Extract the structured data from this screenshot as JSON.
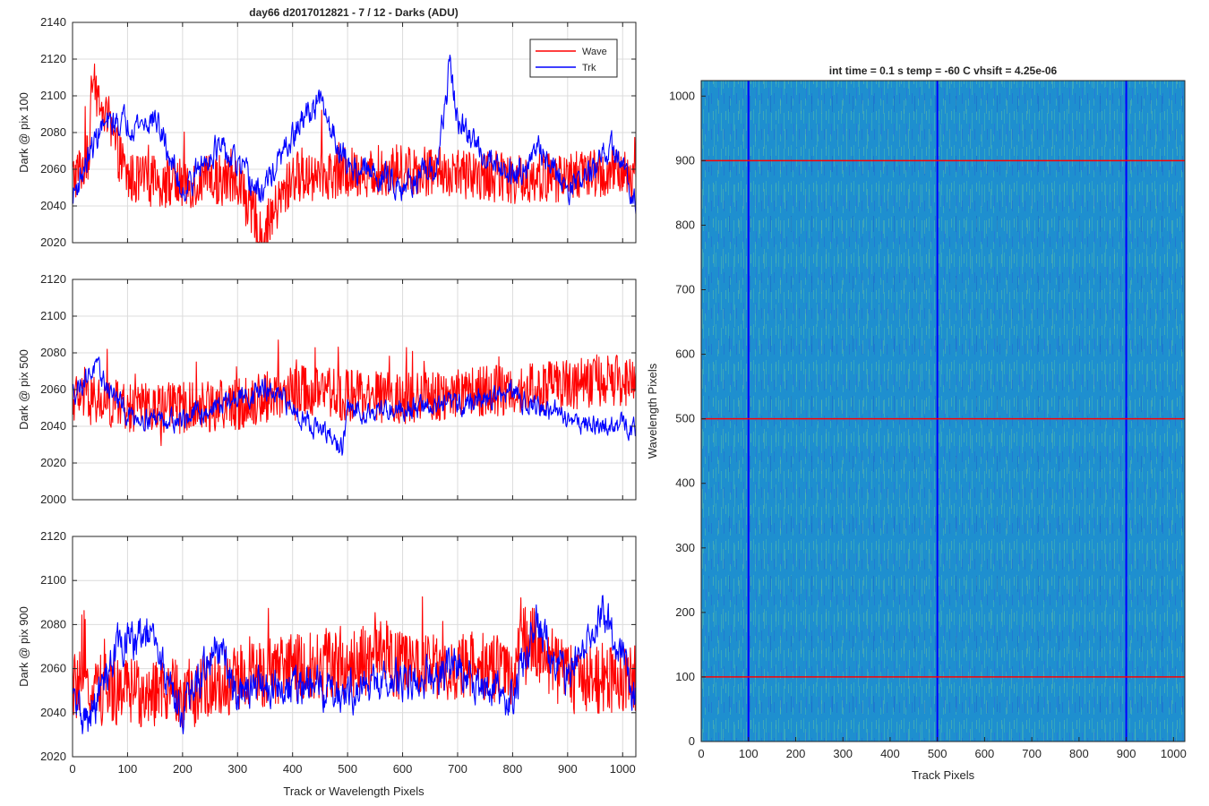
{
  "chart_data": [
    {
      "type": "line",
      "title": "day66 d2017012821 - 7 / 12 - Darks (ADU)",
      "xlabel": "",
      "ylabel": "Dark @ pix 100",
      "xlim": [
        0,
        1024
      ],
      "ylim": [
        2020,
        2140
      ],
      "xticks": [
        0,
        100,
        200,
        300,
        400,
        500,
        600,
        700,
        800,
        900,
        1000
      ],
      "yticks": [
        2020,
        2040,
        2060,
        2080,
        2100,
        2120,
        2140
      ],
      "grid": true,
      "legend": "top-right",
      "series": [
        {
          "name": "Wave",
          "color": "#ff0000",
          "x": [
            0,
            30,
            35,
            100,
            200,
            300,
            342,
            400,
            500,
            600,
            700,
            800,
            900,
            1000,
            1024
          ],
          "values": [
            2055,
            2066,
            2108,
            2055,
            2052,
            2055,
            2022,
            2056,
            2058,
            2060,
            2058,
            2055,
            2056,
            2058,
            2055
          ]
        },
        {
          "name": "Trk",
          "color": "#0000ff",
          "x": [
            0,
            50,
            80,
            130,
            150,
            200,
            260,
            300,
            340,
            430,
            450,
            500,
            600,
            660,
            680,
            685,
            700,
            750,
            800,
            850,
            900,
            950,
            980,
            1024
          ],
          "values": [
            2045,
            2082,
            2086,
            2085,
            2088,
            2048,
            2072,
            2062,
            2046,
            2092,
            2096,
            2062,
            2052,
            2058,
            2100,
            2120,
            2085,
            2068,
            2058,
            2070,
            2050,
            2060,
            2072,
            2045
          ]
        }
      ]
    },
    {
      "type": "line",
      "title": "",
      "xlabel": "",
      "ylabel": "Dark @ pix 500",
      "xlim": [
        0,
        1024
      ],
      "ylim": [
        2000,
        2120
      ],
      "xticks": [
        0,
        100,
        200,
        300,
        400,
        500,
        600,
        700,
        800,
        900,
        1000
      ],
      "yticks": [
        2000,
        2020,
        2040,
        2060,
        2080,
        2100,
        2120
      ],
      "grid": true,
      "series": [
        {
          "name": "Wave",
          "color": "#ff0000",
          "x": [
            0,
            100,
            200,
            300,
            400,
            500,
            600,
            700,
            800,
            900,
            1000,
            1024
          ],
          "values": [
            2056,
            2050,
            2050,
            2052,
            2060,
            2057,
            2055,
            2058,
            2060,
            2063,
            2065,
            2064
          ]
        },
        {
          "name": "Trk",
          "color": "#0000ff",
          "x": [
            0,
            40,
            100,
            200,
            300,
            350,
            400,
            490,
            500,
            600,
            700,
            800,
            850,
            900,
            950,
            1024
          ],
          "values": [
            2058,
            2072,
            2046,
            2044,
            2055,
            2060,
            2050,
            2028,
            2048,
            2050,
            2052,
            2058,
            2050,
            2045,
            2040,
            2040
          ]
        }
      ]
    },
    {
      "type": "line",
      "title": "",
      "xlabel": "Track or Wavelength Pixels",
      "ylabel": "Dark @ pix 900",
      "xlim": [
        0,
        1024
      ],
      "ylim": [
        2020,
        2120
      ],
      "xticks": [
        0,
        100,
        200,
        300,
        400,
        500,
        600,
        700,
        800,
        900,
        1000
      ],
      "yticks": [
        2020,
        2040,
        2060,
        2080,
        2100,
        2120
      ],
      "grid": true,
      "series": [
        {
          "name": "Wave",
          "color": "#ff0000",
          "x": [
            0,
            100,
            200,
            300,
            400,
            500,
            570,
            600,
            700,
            800,
            815,
            900,
            1000,
            1024
          ],
          "values": [
            2052,
            2050,
            2048,
            2055,
            2060,
            2062,
            2066,
            2060,
            2062,
            2058,
            2078,
            2055,
            2056,
            2055
          ]
        },
        {
          "name": "Trk",
          "color": "#0000ff",
          "x": [
            0,
            30,
            80,
            140,
            200,
            260,
            300,
            400,
            500,
            600,
            700,
            800,
            840,
            900,
            960,
            1000,
            1024
          ],
          "values": [
            2045,
            2035,
            2070,
            2075,
            2040,
            2070,
            2050,
            2052,
            2050,
            2055,
            2060,
            2045,
            2082,
            2055,
            2088,
            2065,
            2045
          ]
        }
      ]
    },
    {
      "type": "heatmap",
      "title": "int time = 0.1 s   temp = -60 C   vhsift = 4.25e-06",
      "xlabel": "Track Pixels",
      "ylabel": "Wavelength Pixels",
      "xlim": [
        0,
        1024
      ],
      "ylim": [
        0,
        1024
      ],
      "xticks": [
        0,
        100,
        200,
        300,
        400,
        500,
        600,
        700,
        800,
        900,
        1000
      ],
      "yticks": [
        0,
        100,
        200,
        300,
        400,
        500,
        600,
        700,
        800,
        900,
        1000
      ],
      "colormap": "parula",
      "vertical_marker_lines": {
        "x": [
          100,
          500,
          900
        ],
        "color": "#0000ff"
      },
      "horizontal_marker_lines": {
        "y": [
          100,
          500,
          900
        ],
        "color": "#ff0000"
      }
    }
  ]
}
